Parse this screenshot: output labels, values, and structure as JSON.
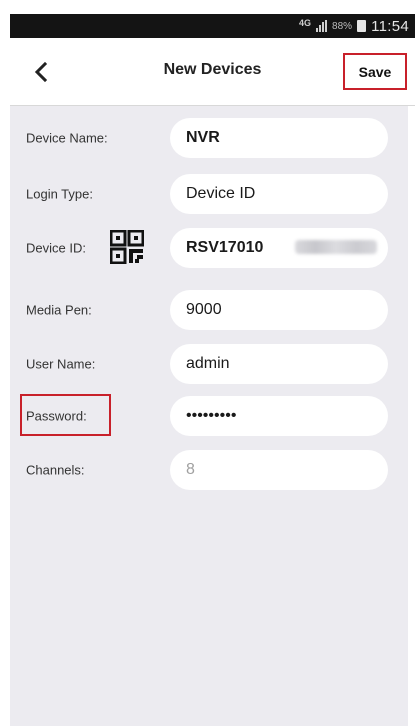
{
  "status_bar": {
    "network": "4G",
    "battery": "88%",
    "time": "11:54"
  },
  "header": {
    "title": "New Devices",
    "save_label": "Save"
  },
  "form": {
    "device_name": {
      "label": "Device Name:",
      "value": "NVR"
    },
    "login_type": {
      "label": "Login Type:",
      "value": "Device ID"
    },
    "device_id": {
      "label": "Device ID:",
      "value": "RSV17010"
    },
    "media_port": {
      "label": "Media Pen:",
      "value": "9000"
    },
    "user_name": {
      "label": "User Name:",
      "value": "admin"
    },
    "password": {
      "label": "Password:",
      "value": "•••••••••"
    },
    "channels": {
      "label": "Channels:",
      "value": "8"
    }
  },
  "colors": {
    "highlight": "#c8202a",
    "form_background": "#ecebf0",
    "status_bar": "#141414"
  },
  "icons": {
    "back": "chevron-left-icon",
    "qr": "qr-code-icon",
    "signal": "signal-icon",
    "battery": "battery-icon"
  }
}
